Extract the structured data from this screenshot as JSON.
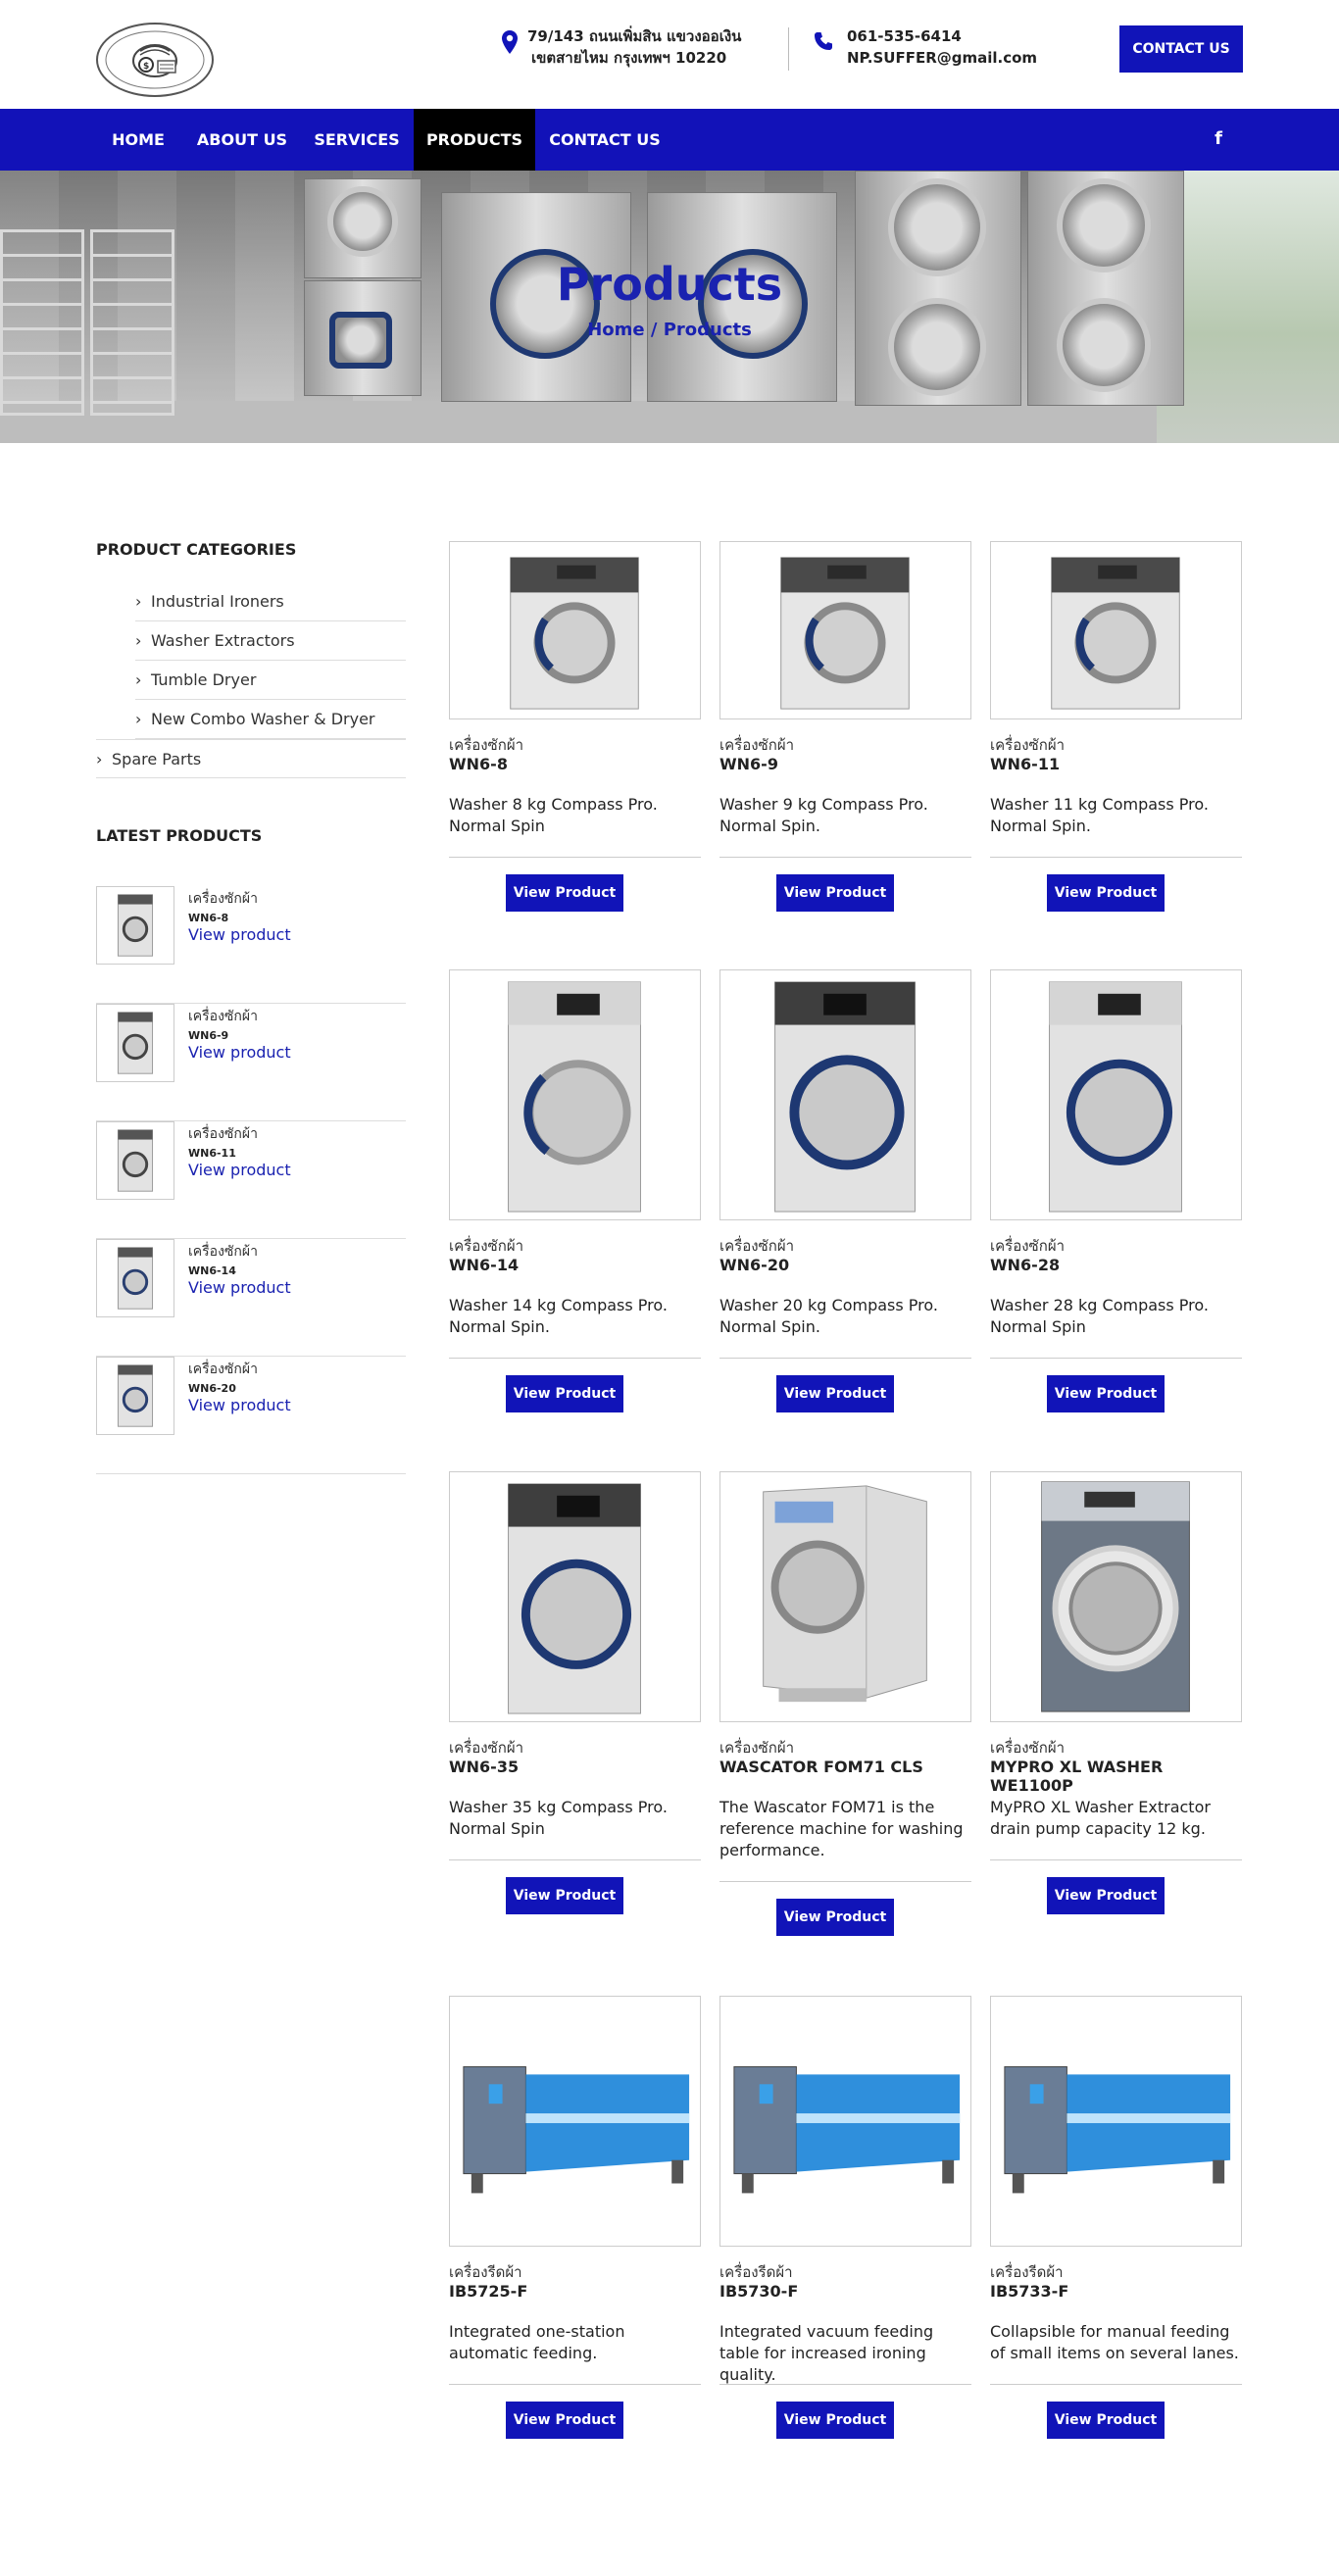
{
  "header": {
    "address_line1": "79/143  ถนนเพิ่มสิน  แขวงออเงิน",
    "address_line2": "เขตสายไหม กรุงเทพฯ 10220",
    "phone": "061-535-6414",
    "email": "NP.SUFFER@gmail.com",
    "cta_label": "CONTACT US"
  },
  "nav": {
    "items": [
      {
        "label": "HOME"
      },
      {
        "label": "ABOUT US"
      },
      {
        "label": "SERVICES"
      },
      {
        "label": "PRODUCTS"
      },
      {
        "label": "CONTACT US"
      }
    ],
    "active": "PRODUCTS",
    "social_icon": "facebook-icon",
    "social_glyph": "f"
  },
  "hero": {
    "title": "Products",
    "breadcrumb": "Home / Products"
  },
  "sidebar": {
    "categories_heading": "PRODUCT CATEGORIES",
    "categories": [
      {
        "label": "Industrial Ironers"
      },
      {
        "label": "Washer Extractors"
      },
      {
        "label": "Tumble Dryer"
      },
      {
        "label": "New Combo Washer & Dryer"
      },
      {
        "label": "Spare Parts"
      }
    ],
    "latest_heading": "LATEST PRODUCTS",
    "latest": [
      {
        "category": "เครื่องซักผ้า",
        "code": "WN6-8",
        "link": "View product"
      },
      {
        "category": "เครื่องซักผ้า",
        "code": "WN6-9",
        "link": "View product"
      },
      {
        "category": "เครื่องซักผ้า",
        "code": "WN6-11",
        "link": "View product"
      },
      {
        "category": "เครื่องซักผ้า",
        "code": "WN6-14",
        "link": "View product"
      },
      {
        "category": "เครื่องซักผ้า",
        "code": "WN6-20",
        "link": "View product"
      }
    ]
  },
  "products": [
    {
      "category": "เครื่องซักผ้า",
      "name": "WN6-8",
      "desc": "Washer 8 kg Compass Pro. Normal Spin",
      "button": "View Product"
    },
    {
      "category": "เครื่องซักผ้า",
      "name": "WN6-9",
      "desc": "Washer 9 kg Compass Pro. Normal Spin.",
      "button": "View Product"
    },
    {
      "category": "เครื่องซักผ้า",
      "name": "WN6-11",
      "desc": "Washer 11 kg Compass Pro. Normal Spin.",
      "button": "View Product"
    },
    {
      "category": "เครื่องซักผ้า",
      "name": "WN6-14",
      "desc": "Washer 14 kg Compass Pro. Normal Spin.",
      "button": "View Product"
    },
    {
      "category": "เครื่องซักผ้า",
      "name": "WN6-20",
      "desc": "Washer 20 kg Compass Pro. Normal Spin.",
      "button": "View Product"
    },
    {
      "category": "เครื่องซักผ้า",
      "name": "WN6-28",
      "desc": "Washer 28 kg Compass Pro. Normal Spin",
      "button": "View Product"
    },
    {
      "category": "เครื่องซักผ้า",
      "name": "WN6-35",
      "desc": "Washer 35 kg Compass Pro. Normal Spin",
      "button": "View Product"
    },
    {
      "category": "เครื่องซักผ้า",
      "name": "WASCATOR FOM71 CLS",
      "desc": "The Wascator FOM71 is the reference machine for washing performance.",
      "button": "View Product"
    },
    {
      "category": "เครื่องซักผ้า",
      "name": "MYPRO XL WASHER WE1100P",
      "desc": "MyPRO XL Washer Extractor drain pump capacity 12 kg.",
      "button": "View Product"
    },
    {
      "category": "เครื่องรีดผ้า",
      "name": "IB5725-F",
      "desc": "Integrated one-station automatic feeding.",
      "button": "View Product"
    },
    {
      "category": "เครื่องรีดผ้า",
      "name": "IB5730-F",
      "desc": "Integrated vacuum feeding table for increased ironing quality.",
      "button": "View Product"
    },
    {
      "category": "เครื่องรีดผ้า",
      "name": "IB5733-F",
      "desc": "Collapsible for manual feeding of small items on several lanes.",
      "button": "View Product"
    }
  ],
  "colors": {
    "brand_blue": "#1114b8",
    "nav_active": "#000000",
    "link_blue": "#1a22b0"
  }
}
